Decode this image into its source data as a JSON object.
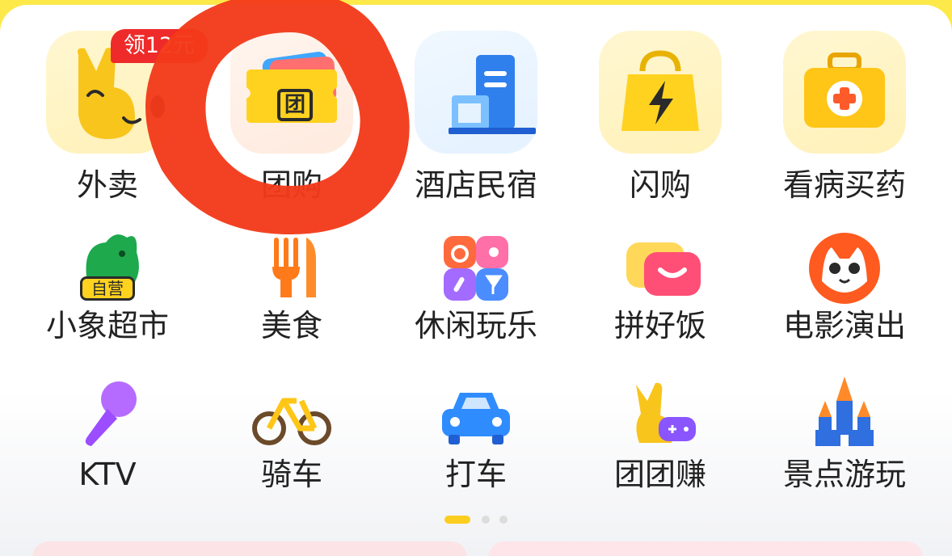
{
  "promo_badge": "领12元",
  "row1": [
    {
      "key": "waimai",
      "label": "外卖",
      "icon": "yellow-mascot-icon"
    },
    {
      "key": "tuangou",
      "label": "团购",
      "icon": "group-buy-ticket-icon",
      "ticket_char": "团"
    },
    {
      "key": "hotel",
      "label": "酒店民宿",
      "icon": "hotel-building-icon"
    },
    {
      "key": "shangou",
      "label": "闪购",
      "icon": "lightning-bag-icon"
    },
    {
      "key": "medicine",
      "label": "看病买药",
      "icon": "medical-kit-icon"
    }
  ],
  "row2": [
    {
      "key": "supermarket",
      "label": "小象超市",
      "icon": "elephant-icon",
      "tag": "自营"
    },
    {
      "key": "food",
      "label": "美食",
      "icon": "fork-knife-icon"
    },
    {
      "key": "leisure",
      "label": "休闲玩乐",
      "icon": "leisure-grid-icon"
    },
    {
      "key": "pinhaofan",
      "label": "拼好饭",
      "icon": "bowl-icon"
    },
    {
      "key": "movies",
      "label": "电影演出",
      "icon": "cat-face-icon"
    }
  ],
  "row3": [
    {
      "key": "ktv",
      "label": "KTV",
      "icon": "microphone-icon"
    },
    {
      "key": "bike",
      "label": "骑车",
      "icon": "bicycle-icon"
    },
    {
      "key": "taxi",
      "label": "打车",
      "icon": "car-icon"
    },
    {
      "key": "tuantuanzhuan",
      "label": "团团赚",
      "icon": "mascot-gamepad-icon"
    },
    {
      "key": "scenic",
      "label": "景点游玩",
      "icon": "castle-icon"
    }
  ],
  "pagination": {
    "total": 3,
    "active": 1
  },
  "colors": {
    "brand_yellow": "#fde94a",
    "badge_red": "#ef2a2a",
    "annotation_red": "#f23a1a"
  },
  "annotation": "red-hand-drawn-circle-around-tuangou"
}
